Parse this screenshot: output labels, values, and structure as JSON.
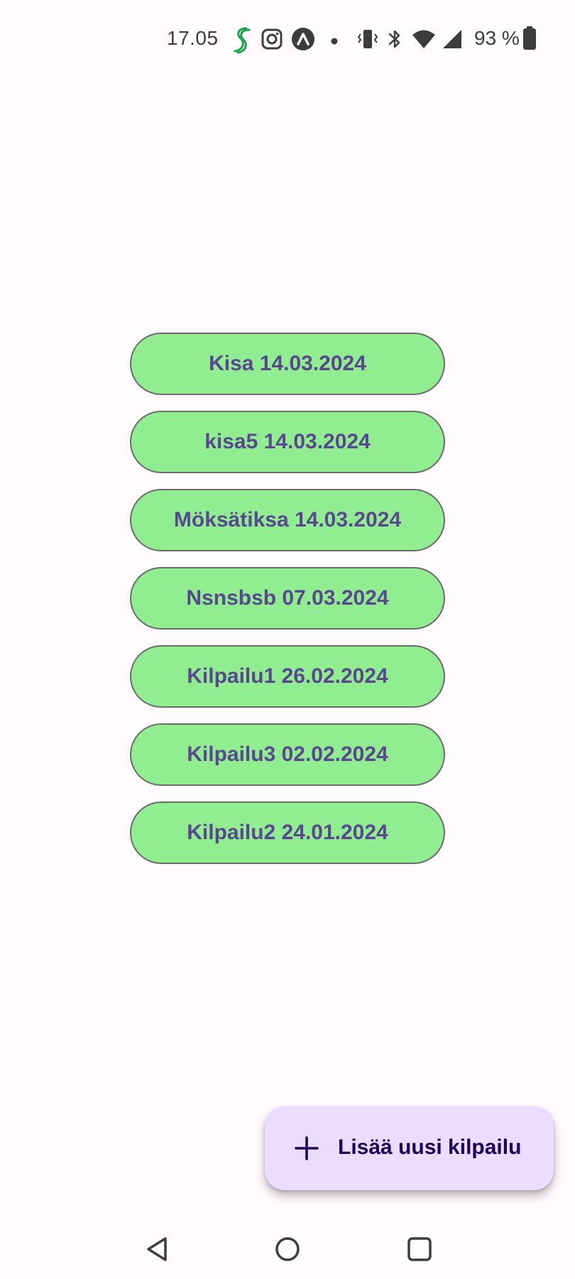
{
  "status_bar": {
    "time": "17.05",
    "battery": "93 %",
    "icons": [
      "s-app-icon",
      "instagram-icon",
      "arrow-app-icon",
      "dot-icon",
      "vibrate-icon",
      "bluetooth-icon",
      "wifi-icon",
      "signal-icon",
      "battery-icon"
    ]
  },
  "competitions": [
    {
      "label": "Kisa 14.03.2024"
    },
    {
      "label": "kisa5 14.03.2024"
    },
    {
      "label": "Möksätiksa 14.03.2024"
    },
    {
      "label": "Nsnsbsb 07.03.2024"
    },
    {
      "label": "Kilpailu1 26.02.2024"
    },
    {
      "label": "Kilpailu3 02.02.2024"
    },
    {
      "label": "Kilpailu2 24.01.2024"
    }
  ],
  "fab": {
    "label": "Lisää uusi kilpailu",
    "icon": "plus-icon"
  },
  "nav": {
    "icons": [
      "back-icon",
      "home-icon",
      "recents-icon"
    ]
  },
  "colors": {
    "button_bg": "#90ee90",
    "button_text": "#5a4790",
    "fab_bg": "#eaddff",
    "fab_text": "#21005d"
  }
}
